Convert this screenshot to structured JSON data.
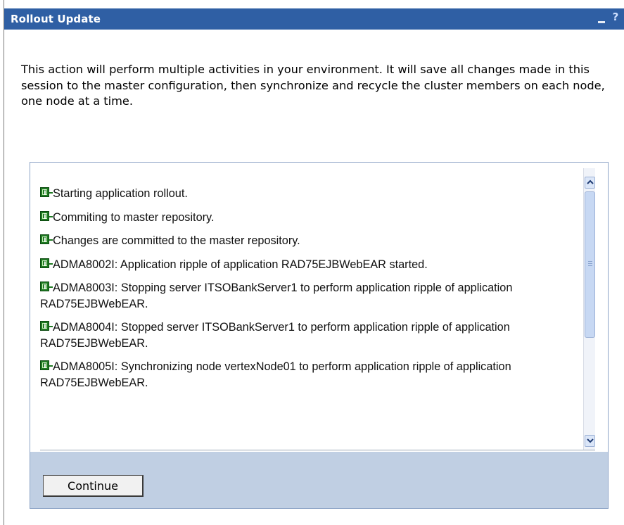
{
  "window": {
    "title": "Rollout Update",
    "controls": {
      "minimize": "_",
      "help": "?"
    }
  },
  "intro": {
    "text": "This action will perform multiple activities in your environment. It will save all changes made in this session to the master configuration, then synchronize and recycle the cluster members on each node, one node at a time."
  },
  "log": {
    "messages": [
      {
        "icon": "info-icon",
        "text": "Starting application rollout."
      },
      {
        "icon": "info-icon",
        "text": "Commiting to master repository."
      },
      {
        "icon": "info-icon",
        "text": "Changes are committed to the master repository."
      },
      {
        "icon": "info-icon",
        "text": "ADMA8002I: Application ripple of application RAD75EJBWebEAR started."
      },
      {
        "icon": "info-icon",
        "text": "ADMA8003I: Stopping server ITSOBankServer1 to perform application ripple of application RAD75EJBWebEAR."
      },
      {
        "icon": "info-icon",
        "text": "ADMA8004I: Stopped server ITSOBankServer1 to perform application ripple of application RAD75EJBWebEAR."
      },
      {
        "icon": "info-icon",
        "text": "ADMA8005I: Synchronizing node vertexNode01 to perform application ripple of application RAD75EJBWebEAR."
      }
    ]
  },
  "buttons": {
    "continue": "Continue"
  },
  "colors": {
    "titlebar": "#2f5fa4",
    "button_bar": "#c0cfe3",
    "info_icon": "#1f7a23"
  }
}
